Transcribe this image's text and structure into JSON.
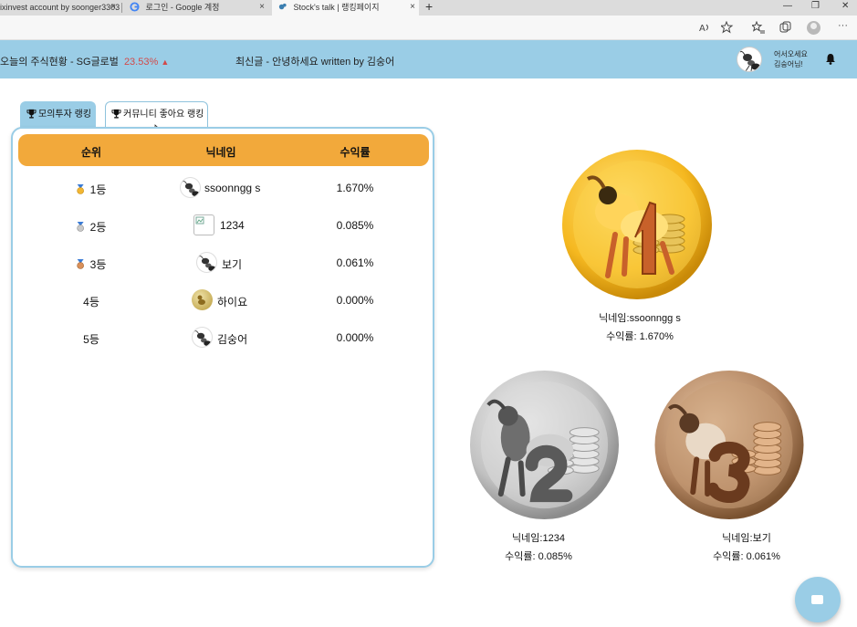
{
  "browser": {
    "tabs": [
      {
        "title": "ixinvest account by soonger3303",
        "close": "×"
      },
      {
        "title": "로그인 - Google 계정",
        "close": "×"
      },
      {
        "title": "Stock's talk | 랭킹페이지",
        "close": "×"
      }
    ],
    "new_tab": "+",
    "window_controls": [
      "—",
      "❐",
      "✕"
    ],
    "toolbar_icons": [
      "read-aloud-icon",
      "favorite-add-icon",
      "favorites-icon",
      "collections-icon",
      "profile-icon",
      "more-icon"
    ],
    "more": "···"
  },
  "header": {
    "ticker_label": "오늘의 주식현황 -  SG글로벌",
    "ticker_pct": "23.53%",
    "ticker_arrow": "▲",
    "latest_post": "최신글 - 안녕하세요 written by 김숭어",
    "welcome_line1": "어서오세요",
    "welcome_line2": "김숭어님!",
    "accent": "#9acde6",
    "up_color": "#d24a4a"
  },
  "ranking_tabs": [
    {
      "label": "모의투자 랭킹",
      "active": true
    },
    {
      "label": "커뮤니티 좋아요 랭킹",
      "active": false
    }
  ],
  "table": {
    "headers": {
      "rank": "순위",
      "nickname": "닉네임",
      "yield": "수익률"
    },
    "header_color": "#f2a93b",
    "rows": [
      {
        "rank": "1등",
        "medal": "gold",
        "avatar": "ant",
        "nickname": "ssoonngg s",
        "yield": "1.670%"
      },
      {
        "rank": "2등",
        "medal": "silver",
        "avatar": "broken-image",
        "nickname": "1234",
        "yield": "0.085%"
      },
      {
        "rank": "3등",
        "medal": "bronze",
        "avatar": "ant",
        "nickname": "보기",
        "yield": "0.061%"
      },
      {
        "rank": "4등",
        "medal": "",
        "avatar": "gold-ant",
        "nickname": "하이요",
        "yield": "0.000%"
      },
      {
        "rank": "5등",
        "medal": "",
        "avatar": "ant",
        "nickname": "김숭어",
        "yield": "0.000%"
      }
    ]
  },
  "podium": {
    "first": {
      "number": "1",
      "nickname": "닉네임:ssoonngg s",
      "yield": "수익률: 1.670%",
      "color": "#f5b820"
    },
    "second": {
      "number": "2",
      "nickname": "닉네임:1234",
      "yield": "수익률: 0.085%",
      "color": "#b8b8b8"
    },
    "third": {
      "number": "3",
      "nickname": "닉네임:보기",
      "yield": "수익률: 0.061%",
      "color": "#b48763"
    }
  }
}
